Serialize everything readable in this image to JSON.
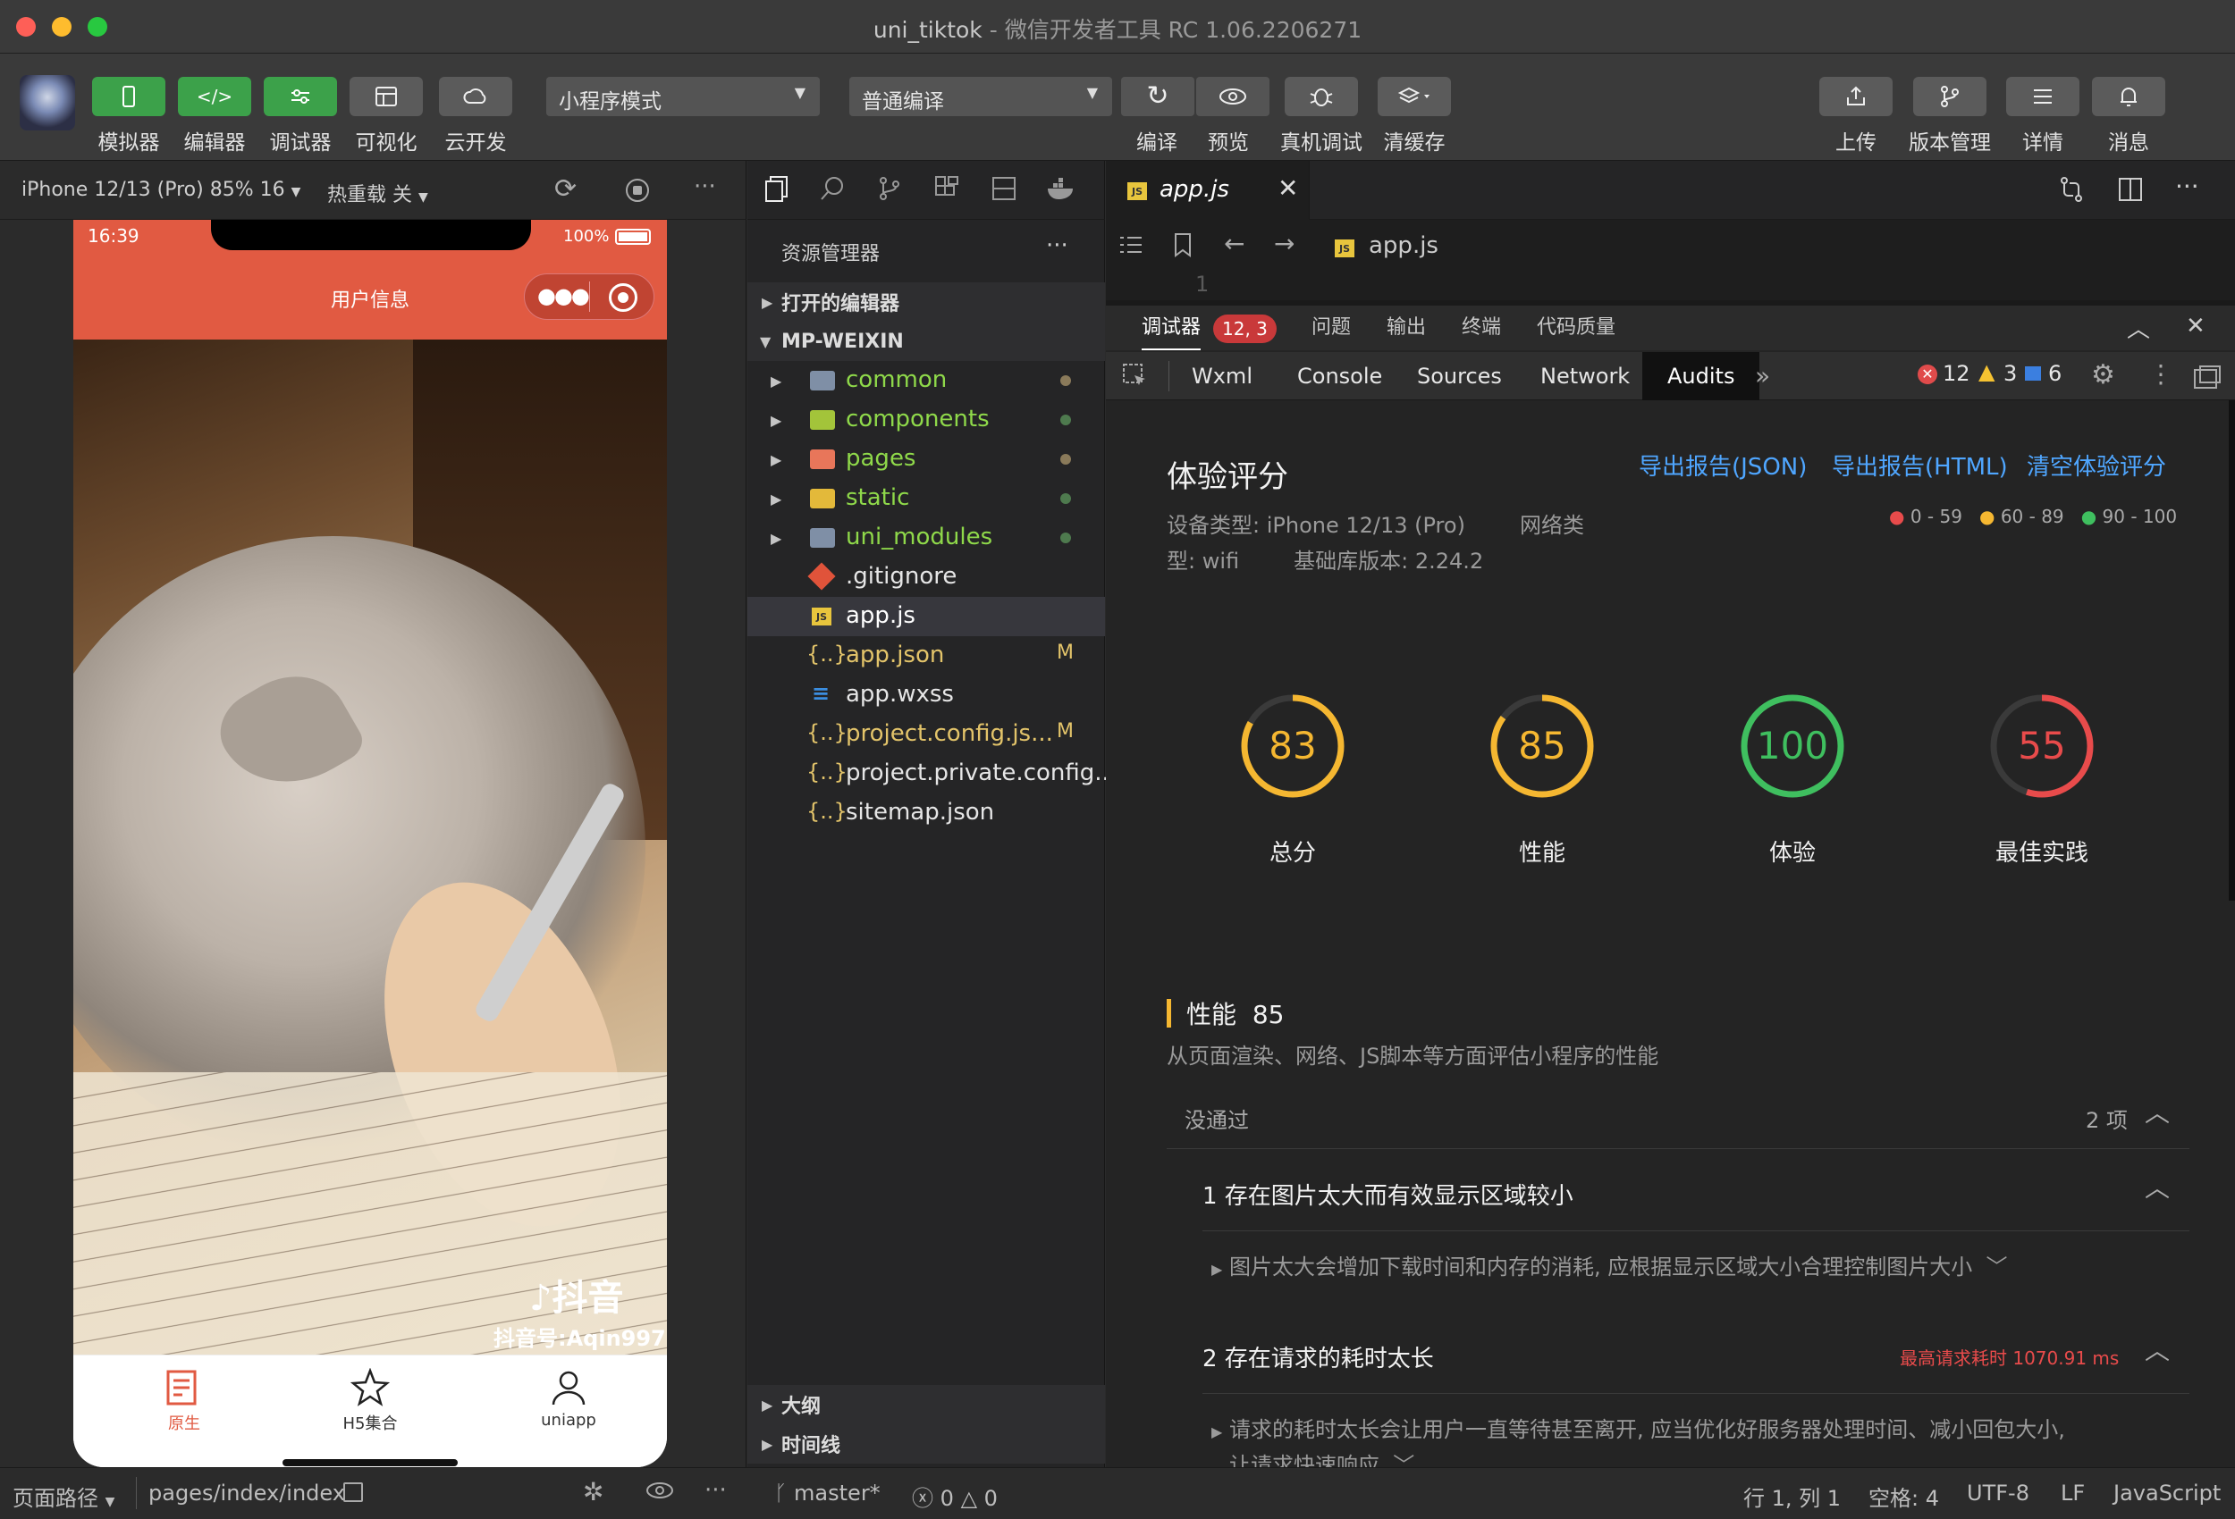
{
  "window": {
    "app_name": "uni_tiktok",
    "separator": "-",
    "subtitle": "微信开发者工具 RC 1.06.2206271"
  },
  "toolbar": {
    "left_buttons": [
      {
        "label": "模拟器",
        "icon": "phone-icon"
      },
      {
        "label": "编辑器",
        "icon": "code-icon"
      },
      {
        "label": "调试器",
        "icon": "debugger-icon"
      },
      {
        "label": "可视化",
        "icon": "layout-icon"
      },
      {
        "label": "云开发",
        "icon": "cloud-icon"
      }
    ],
    "mode_select": "小程序模式",
    "compile_select": "普通编译",
    "mid_buttons": [
      {
        "label": "编译",
        "icon": "refresh-icon"
      },
      {
        "label": "预览",
        "icon": "eye-icon"
      },
      {
        "label": "真机调试",
        "icon": "bug-icon"
      },
      {
        "label": "清缓存",
        "icon": "layers-icon"
      }
    ],
    "right_buttons": [
      {
        "label": "上传",
        "icon": "upload-icon"
      },
      {
        "label": "版本管理",
        "icon": "branch-icon"
      },
      {
        "label": "详情",
        "icon": "menu-icon"
      },
      {
        "label": "消息",
        "icon": "bell-icon"
      }
    ]
  },
  "simulator": {
    "device": "iPhone 12/13 (Pro) 85% 16",
    "hot_reload": "热重载 关",
    "more": "···",
    "status_time": "16:39",
    "battery": "100%",
    "nav_title": "用户信息",
    "watermark_brand": "抖音",
    "watermark_id": "抖音号:Aqin997",
    "tabbar": [
      {
        "label": "原生",
        "active": true
      },
      {
        "label": "H5集合",
        "active": false
      },
      {
        "label": "uniapp",
        "active": false
      }
    ]
  },
  "explorer": {
    "title": "资源管理器",
    "more": "···",
    "open_editors": "打开的编辑器",
    "root": "MP-WEIXIN",
    "items": [
      {
        "name": "common",
        "type": "folder",
        "color": "#7f8fa6"
      },
      {
        "name": "components",
        "type": "folder",
        "color": "#a3c43a"
      },
      {
        "name": "pages",
        "type": "folder",
        "color": "#e8765a"
      },
      {
        "name": "static",
        "type": "folder",
        "color": "#e3b93a"
      },
      {
        "name": "uni_modules",
        "type": "folder",
        "color": "#7f8fa6"
      },
      {
        "name": ".gitignore",
        "type": "git",
        "badge": ""
      },
      {
        "name": "app.js",
        "type": "js",
        "badge": ""
      },
      {
        "name": "app.json",
        "type": "json",
        "badge": "M"
      },
      {
        "name": "app.wxss",
        "type": "css",
        "badge": ""
      },
      {
        "name": "project.config.js...",
        "type": "json",
        "badge": "M"
      },
      {
        "name": "project.private.config...",
        "type": "json",
        "badge": ""
      },
      {
        "name": "sitemap.json",
        "type": "json",
        "badge": ""
      }
    ],
    "outline": "大纲",
    "timeline": "时间线"
  },
  "editor": {
    "tab": "app.js",
    "breadcrumb": "app.js",
    "line_number": "1"
  },
  "devtools": {
    "panel_tabs": [
      {
        "label": "调试器",
        "badge": "12, 3"
      },
      {
        "label": "问题"
      },
      {
        "label": "输出"
      },
      {
        "label": "终端"
      },
      {
        "label": "代码质量"
      }
    ],
    "chrome_tabs": [
      "Wxml",
      "Console",
      "Sources",
      "Network",
      "Audits"
    ],
    "active_chrome_tab": "Audits",
    "errors": "12",
    "warnings": "3",
    "infos": "6"
  },
  "audits": {
    "title": "体验评分",
    "export_json": "导出报告(JSON)",
    "export_html": "导出报告(HTML)",
    "clear": "清空体验评分",
    "device_line1": "设备类型: iPhone 12/13 (Pro)        网络类",
    "device_line2": "型: wifi        基础库版本: 2.24.2",
    "legend": [
      "0 - 59",
      "60 - 89",
      "90 - 100"
    ],
    "scores": [
      {
        "label": "总分",
        "value": 83,
        "color": "#f5b731"
      },
      {
        "label": "性能",
        "value": 85,
        "color": "#f5b731"
      },
      {
        "label": "体验",
        "value": 100,
        "color": "#3fbf5f"
      },
      {
        "label": "最佳实践",
        "value": 55,
        "color": "#e84b4b"
      }
    ],
    "section_title": "性能",
    "section_score": "85",
    "section_desc": "从页面渲染、网络、JS脚本等方面评估小程序的性能",
    "failed_label": "没通过",
    "failed_count": "2 项",
    "issues": [
      {
        "title": "1 存在图片太大而有效显示区域较小",
        "meta": "",
        "detail": "图片太大会增加下载时间和内存的消耗, 应根据显示区域大小合理控制图片大小"
      },
      {
        "title": "2 存在请求的耗时太长",
        "meta": "最高请求耗时 1070.91 ms",
        "detail": "请求的耗时太长会让用户一直等待甚至离开, 应当优化好服务器处理时间、减小回包大小,",
        "detail2": "让请求快速响应"
      }
    ]
  },
  "statusbar": {
    "page_path_label": "页面路径",
    "page_path": "pages/index/index",
    "branch": "master*",
    "errors": "0",
    "warnings": "0",
    "position": "行 1, 列 1",
    "spaces": "空格: 4",
    "encoding": "UTF-8",
    "eol": "LF",
    "language": "JavaScript"
  }
}
